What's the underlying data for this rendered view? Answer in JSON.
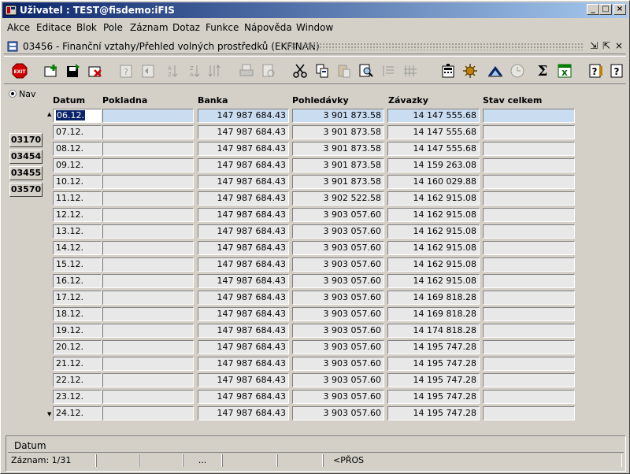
{
  "window": {
    "title": "Uživatel : TEST@fisdemo:iFIS",
    "buttons": {
      "minimize": "_",
      "maximize": "□",
      "close": "×"
    }
  },
  "menu": [
    {
      "label": "Akce"
    },
    {
      "label": "Editace"
    },
    {
      "label": "Blok"
    },
    {
      "label": "Pole"
    },
    {
      "label": "Záznam"
    },
    {
      "label": "Dotaz"
    },
    {
      "label": "Funkce"
    },
    {
      "label": "Nápověda"
    },
    {
      "label": "Window"
    }
  ],
  "form": {
    "title": "03456 - Finanční vztahy/Přehled volných prostředků (EKFINAN)",
    "controls": {
      "minimize": "⇲",
      "restore": "⇱",
      "close": "×"
    }
  },
  "toolbar": {
    "exit_label": "EXIT",
    "icons": [
      "exit-icon",
      "add-record-icon",
      "save-icon",
      "delete-record-icon",
      "query-icon",
      "query-exec-icon",
      "sort-asc-icon",
      "sort-desc-icon",
      "sort-multi-icon",
      "print-icon",
      "print-preview-icon",
      "cut-icon",
      "copy-icon",
      "paste-icon",
      "find-icon",
      "first-icon",
      "last-icon",
      "calculator-icon",
      "settings-icon",
      "chart-icon",
      "clock-icon",
      "sum-icon",
      "excel-icon",
      "help-icon",
      "context-help-icon"
    ],
    "sum_glyph": "Σ",
    "excel_glyph": "X",
    "help_glyph": "?"
  },
  "nav": {
    "radio_label": "Nav",
    "buttons": [
      "03170",
      "03454",
      "03455",
      "03570"
    ]
  },
  "table": {
    "headers": [
      "Datum",
      "Pokladna",
      "Banka",
      "Pohledávky",
      "Závazky",
      "Stav celkem"
    ],
    "rows": [
      {
        "datum": "06.12.",
        "pokladna": "",
        "banka": "147 987 684.43",
        "pohledavky": "3 901 873.58",
        "zavazky": "14 147 555.68",
        "stav": ""
      },
      {
        "datum": "07.12.",
        "pokladna": "",
        "banka": "147 987 684.43",
        "pohledavky": "3 901 873.58",
        "zavazky": "14 147 555.68",
        "stav": ""
      },
      {
        "datum": "08.12.",
        "pokladna": "",
        "banka": "147 987 684.43",
        "pohledavky": "3 901 873.58",
        "zavazky": "14 147 555.68",
        "stav": ""
      },
      {
        "datum": "09.12.",
        "pokladna": "",
        "banka": "147 987 684.43",
        "pohledavky": "3 901 873.58",
        "zavazky": "14 159 263.08",
        "stav": ""
      },
      {
        "datum": "10.12.",
        "pokladna": "",
        "banka": "147 987 684.43",
        "pohledavky": "3 901 873.58",
        "zavazky": "14 160 029.88",
        "stav": ""
      },
      {
        "datum": "11.12.",
        "pokladna": "",
        "banka": "147 987 684.43",
        "pohledavky": "3 902 522.58",
        "zavazky": "14 162 915.08",
        "stav": ""
      },
      {
        "datum": "12.12.",
        "pokladna": "",
        "banka": "147 987 684.43",
        "pohledavky": "3 903 057.60",
        "zavazky": "14 162 915.08",
        "stav": ""
      },
      {
        "datum": "13.12.",
        "pokladna": "",
        "banka": "147 987 684.43",
        "pohledavky": "3 903 057.60",
        "zavazky": "14 162 915.08",
        "stav": ""
      },
      {
        "datum": "14.12.",
        "pokladna": "",
        "banka": "147 987 684.43",
        "pohledavky": "3 903 057.60",
        "zavazky": "14 162 915.08",
        "stav": ""
      },
      {
        "datum": "15.12.",
        "pokladna": "",
        "banka": "147 987 684.43",
        "pohledavky": "3 903 057.60",
        "zavazky": "14 162 915.08",
        "stav": ""
      },
      {
        "datum": "16.12.",
        "pokladna": "",
        "banka": "147 987 684.43",
        "pohledavky": "3 903 057.60",
        "zavazky": "14 162 915.08",
        "stav": ""
      },
      {
        "datum": "17.12.",
        "pokladna": "",
        "banka": "147 987 684.43",
        "pohledavky": "3 903 057.60",
        "zavazky": "14 169 818.28",
        "stav": ""
      },
      {
        "datum": "18.12.",
        "pokladna": "",
        "banka": "147 987 684.43",
        "pohledavky": "3 903 057.60",
        "zavazky": "14 169 818.28",
        "stav": ""
      },
      {
        "datum": "19.12.",
        "pokladna": "",
        "banka": "147 987 684.43",
        "pohledavky": "3 903 057.60",
        "zavazky": "14 174 818.28",
        "stav": ""
      },
      {
        "datum": "20.12.",
        "pokladna": "",
        "banka": "147 987 684.43",
        "pohledavky": "3 903 057.60",
        "zavazky": "14 195 747.28",
        "stav": ""
      },
      {
        "datum": "21.12.",
        "pokladna": "",
        "banka": "147 987 684.43",
        "pohledavky": "3 903 057.60",
        "zavazky": "14 195 747.28",
        "stav": ""
      },
      {
        "datum": "22.12.",
        "pokladna": "",
        "banka": "147 987 684.43",
        "pohledavky": "3 903 057.60",
        "zavazky": "14 195 747.28",
        "stav": ""
      },
      {
        "datum": "23.12.",
        "pokladna": "",
        "banka": "147 987 684.43",
        "pohledavky": "3 903 057.60",
        "zavazky": "14 195 747.28",
        "stav": ""
      },
      {
        "datum": "24.12.",
        "pokladna": "",
        "banka": "147 987 684.43",
        "pohledavky": "3 903 057.60",
        "zavazky": "14 195 747.28",
        "stav": ""
      }
    ]
  },
  "status": {
    "field_label": "Datum",
    "record": "Záznam: 1/31",
    "ellipsis": "...",
    "mode": "<PŘOS"
  },
  "colors": {
    "title_start": "#0a246a",
    "title_end": "#a6caf0",
    "face": "#d4d0c8",
    "active_row": "#c9dcf0"
  }
}
